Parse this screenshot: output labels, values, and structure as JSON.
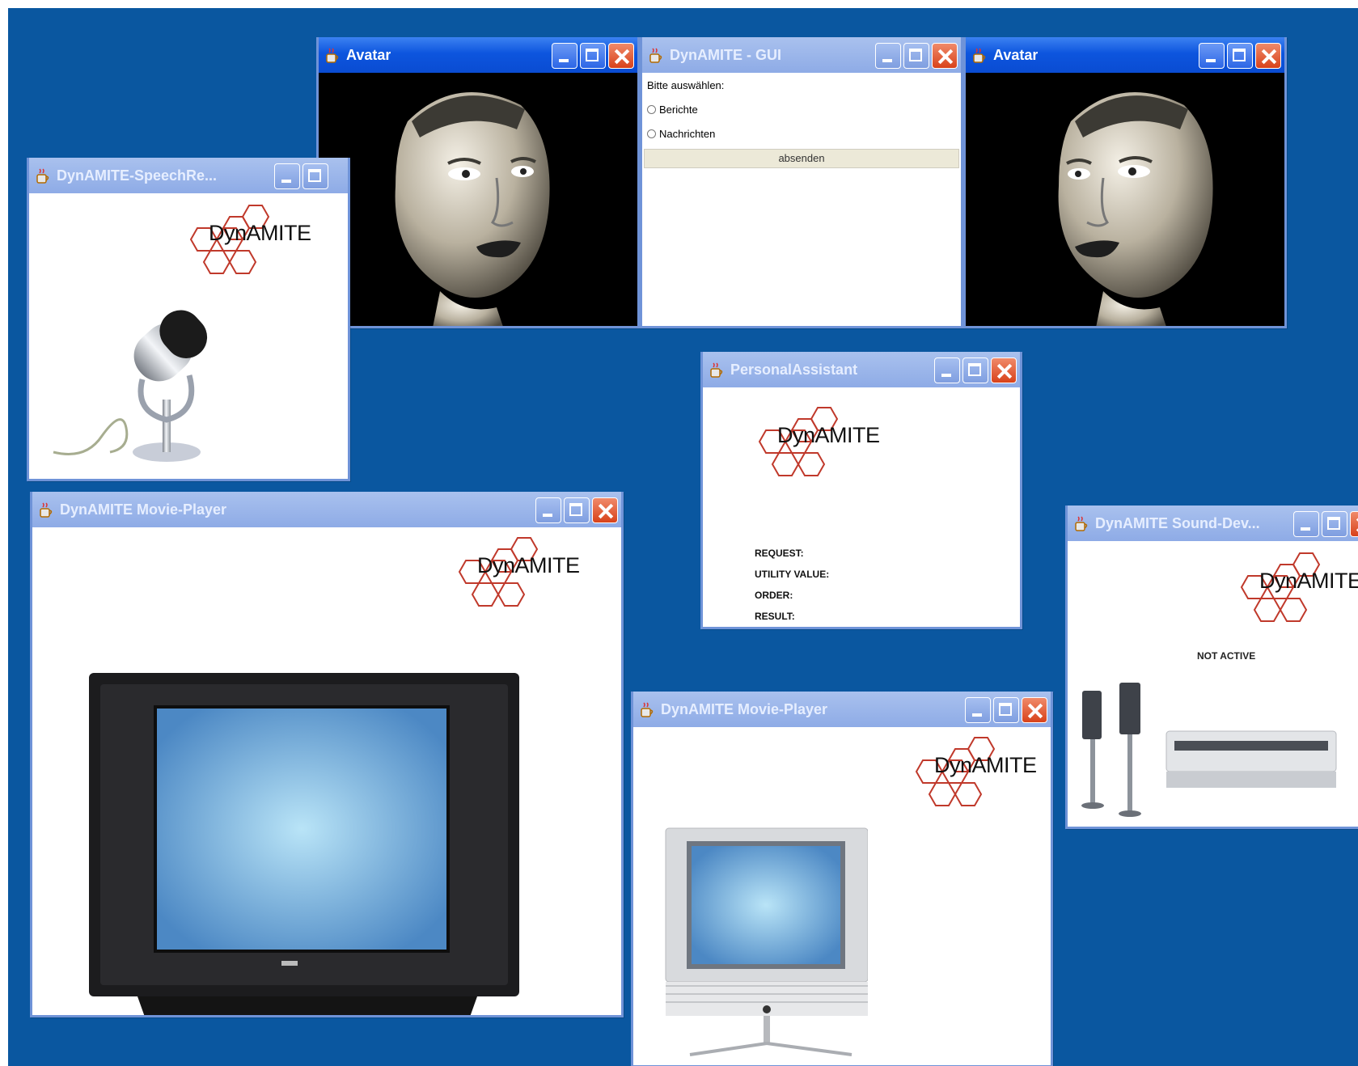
{
  "windows": {
    "avatar_left": {
      "title": "Avatar"
    },
    "gui": {
      "title": "DynAMITE - GUI",
      "prompt": "Bitte auswählen:",
      "options": [
        "Berichte",
        "Nachrichten"
      ],
      "submit_label": "absenden"
    },
    "avatar_right": {
      "title": "Avatar"
    },
    "speech": {
      "title": "DynAMITE-SpeechRe...",
      "logo": "DynAMITE"
    },
    "assistant": {
      "title": "PersonalAssistant",
      "logo": "DynAMITE",
      "fields": [
        "REQUEST:",
        "UTILITY VALUE:",
        "ORDER:",
        "RESULT:"
      ]
    },
    "movie_large": {
      "title": "DynAMITE Movie-Player",
      "logo": "DynAMITE"
    },
    "movie_small": {
      "title": "DynAMITE Movie-Player",
      "logo": "DynAMITE"
    },
    "sound": {
      "title": "DynAMITE Sound-Dev...",
      "logo": "DynAMITE",
      "status": "NOT ACTIVE"
    }
  },
  "icons": {
    "java_app": "java-coffee-cup-icon",
    "minimize": "minimize-icon",
    "maximize": "maximize-icon",
    "close": "close-icon"
  },
  "colors": {
    "desktop": "#0a57a0",
    "active_titlebar": "#0d55de",
    "inactive_titlebar": "#8eabe6",
    "close_button": "#d8421a",
    "logo_hexagon": "#c0392b"
  }
}
